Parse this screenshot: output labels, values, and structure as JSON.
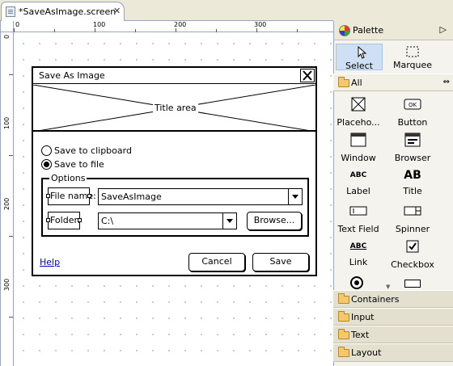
{
  "editor_tab": {
    "title": "*SaveAsImage.screen",
    "close": "✕"
  },
  "rulers": {
    "top_labels": [
      "0",
      "100",
      "200",
      "300"
    ],
    "left_labels": [
      "0",
      "100",
      "200",
      "300"
    ]
  },
  "dialog": {
    "title": "Save As Image",
    "title_area_label": "Title area",
    "radio_clipboard": "Save to clipboard",
    "radio_file": "Save to file",
    "radio_selected": "file",
    "options_legend": "Options",
    "file_name_label": "File name:",
    "file_name_value": "SaveAsImage",
    "folder_label": "Folder:",
    "folder_value": "C:\\",
    "browse_button": "Browse...",
    "help_link": "Help",
    "cancel_button": "Cancel",
    "save_button": "Save"
  },
  "palette": {
    "title": "Palette",
    "tools": [
      {
        "label": "Select",
        "icon": "arrow-cursor-icon",
        "selected": true
      },
      {
        "label": "Marquee",
        "icon": "marquee-icon",
        "selected": false
      }
    ],
    "all_drawer": "All",
    "items": [
      {
        "label": "Placeho...",
        "icon": "placeholder-icon"
      },
      {
        "label": "Button",
        "icon": "button-icon"
      },
      {
        "label": "Window",
        "icon": "window-icon"
      },
      {
        "label": "Browser",
        "icon": "browser-icon"
      },
      {
        "label": "Label",
        "icon": "label-icon",
        "glyph": "ABC"
      },
      {
        "label": "Title",
        "icon": "title-icon",
        "glyph": "AB"
      },
      {
        "label": "Text Field",
        "icon": "text-field-icon"
      },
      {
        "label": "Spinner",
        "icon": "spinner-icon"
      },
      {
        "label": "Link",
        "icon": "link-icon",
        "glyph": "ABC"
      },
      {
        "label": "Checkbox",
        "icon": "checkbox-icon"
      }
    ],
    "drawers": [
      "Containers",
      "Input",
      "Text",
      "Layout"
    ]
  }
}
